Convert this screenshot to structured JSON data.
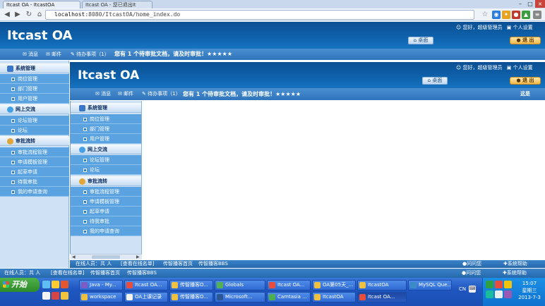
{
  "browser": {
    "tabs": [
      {
        "label": "Itcast OA - ItcastOA"
      },
      {
        "label": "Itcast OA - 您已退出It"
      }
    ],
    "url_host": "localhost",
    "url_rest": ":8080/ItcastOA/home_index.do"
  },
  "outer": {
    "logo": "Itcast OA",
    "greeting": "您好，超级管理员",
    "personal_settings": "个人设置",
    "home_button": "桌面",
    "logout_button": "退 出",
    "msgbar": {
      "message": "消息",
      "mail": "邮件",
      "todo": "待办事项（1）",
      "notice": "您有 1 个待审批文档，请及时审批！★★★★★"
    },
    "footer": {
      "online_label": "在线人员：共",
      "online_unit": "人",
      "online_list": "[查看在线名单]",
      "homepage": "传智播客首页",
      "bbs": "传智播客BBS",
      "ask": "问问您",
      "help": "系统帮助"
    }
  },
  "inner": {
    "logo": "Itcast OA",
    "greeting": "您好，超级管理员",
    "personal_settings": "个人设置",
    "home_button": "桌面",
    "logout_button": "退 出",
    "msgbar": {
      "message": "消息",
      "mail": "邮件",
      "todo": "待办事项（1）",
      "notice": "您有 1 个待审批文档，请及时审批！★★★★★",
      "right": "这是"
    },
    "footer": {
      "online_label": "在线人员：共",
      "online_unit": "人",
      "online_list": "[查看在线名单]",
      "homepage": "传智播客首页",
      "bbs": "传智播客BBS",
      "ask": "问问您",
      "help": "系统帮助"
    }
  },
  "menu": {
    "system": {
      "title": "系统管理",
      "items": [
        "岗位管理",
        "部门管理",
        "用户管理"
      ]
    },
    "online": {
      "title": "网上交流",
      "items": [
        "论坛管理",
        "论坛"
      ]
    },
    "approval": {
      "title": "审批流转",
      "items": [
        "审批流程管理",
        "申请模板管理",
        "起草申请",
        "待我审批",
        "我的申请查询"
      ]
    }
  },
  "taskbar": {
    "start": "开始",
    "row1": [
      "Java - My...",
      "Itcast OA...",
      "传智播客O...",
      "Globals",
      "Itcast OA...",
      "OA第05天_...",
      "ItcastOA",
      "MySQL Que..."
    ],
    "row2": [
      "workspace",
      "OA上课记录",
      "传智播客O...",
      "Microsoft...",
      "Camtasia ...",
      "ItcastOA",
      "Itcast OA..."
    ],
    "lang": "CN",
    "time": "15:07",
    "weekday": "星期三",
    "date": "2013-7-3"
  },
  "colors": {
    "header": "#0e63ad",
    "sidebar": "#cfe2f5",
    "submenu": "#5aa2e0",
    "taskbar": "#1f56bf"
  }
}
